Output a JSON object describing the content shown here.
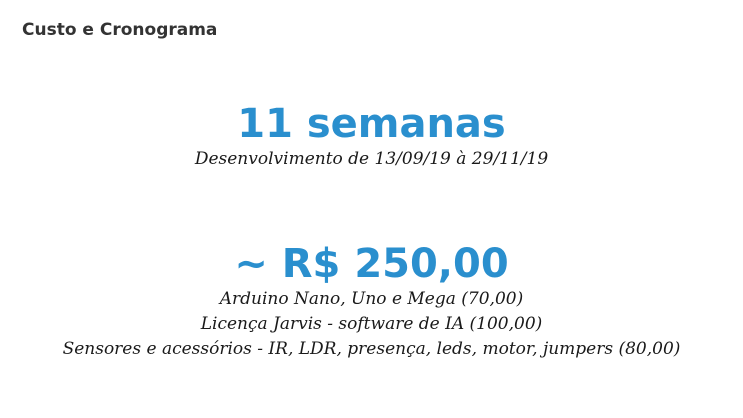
{
  "slide": {
    "title": "Custo e Cronograma"
  },
  "schedule": {
    "headline": "11 semanas",
    "detail": "Desenvolvimento de 13/09/19 à 29/11/19"
  },
  "cost": {
    "headline": "~ R$ 250,00",
    "items": [
      "Arduino Nano, Uno e Mega (70,00)",
      "Licença Jarvis - software de IA (100,00)",
      "Sensores e acessórios - IR, LDR, presença, leds, motor, jumpers (80,00)"
    ]
  },
  "colors": {
    "accent": "#2a8fce",
    "title_text": "#333333",
    "body_text": "#1a1a1a",
    "background": "#ffffff"
  }
}
